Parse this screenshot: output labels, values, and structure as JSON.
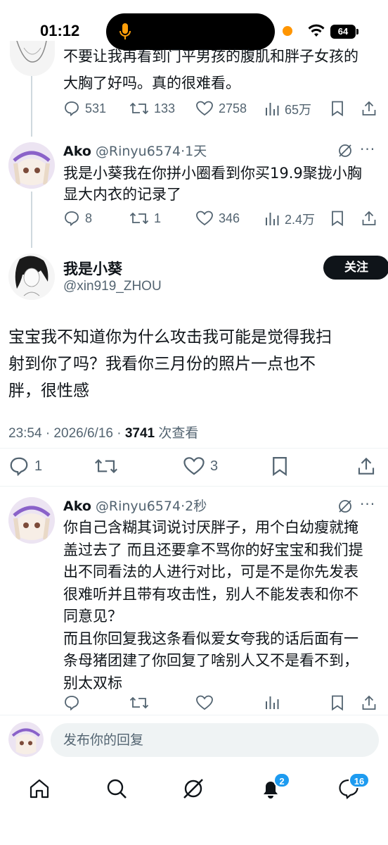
{
  "status": {
    "time": "01:12",
    "battery": "64"
  },
  "tweet_top": {
    "text_partial": "不要让我再看到门平男孩的腹肌和胖子女孩的",
    "text_line2": "大胸了好吗。真的很难看。",
    "replies": "531",
    "retweets": "133",
    "likes": "2758",
    "views": "65万"
  },
  "tweet_ako1": {
    "name": "Ako",
    "handle": "@Rinyu6574",
    "time": "1天",
    "text_line1": "我是小葵我在你拼小圈看到你买19.9聚拢小胸",
    "text_line2": "显大内衣的记录了",
    "replies": "8",
    "retweets": "1",
    "likes": "346",
    "views": "2.4万",
    "more": "···"
  },
  "main_tweet": {
    "name": "我是小葵",
    "handle": "@xin919_ZHOU",
    "follow": "关注",
    "text_line1": "宝宝我不知道你为什么攻击我可能是觉得我扫",
    "text_line2": "射到你了吗？我看你三月份的照片一点也不",
    "text_line3": "胖，很性感",
    "timestamp": "23:54 · 2026/6/16 · ",
    "views_count": "3741",
    "views_label": " 次查看",
    "replies": "1",
    "likes": "3"
  },
  "tweet_ako2": {
    "name": "Ako",
    "handle": "@Rinyu6574",
    "time": "2秒",
    "lines": [
      "你自己含糊其词说讨厌胖子，用个白幼瘦就掩",
      "盖过去了 而且还要拿不骂你的好宝宝和我们提",
      "出不同看法的人进行对比，可是不是你先发表",
      "很难听并且带有攻击性，别人不能发表和你不",
      "同意见？",
      "而且你回复我这条看似爱女夸我的话后面有一",
      "条母猪团建了你回复了啥别人又不是看不到，",
      "别太双标"
    ],
    "more": "···"
  },
  "reply_box": {
    "placeholder": "发布你的回复"
  },
  "tabbar": {
    "notif_badge": "2",
    "msg_badge": "16"
  },
  "colors": {
    "text": "#0f1419",
    "secondary": "#536471",
    "accent": "#1d9bf0"
  }
}
